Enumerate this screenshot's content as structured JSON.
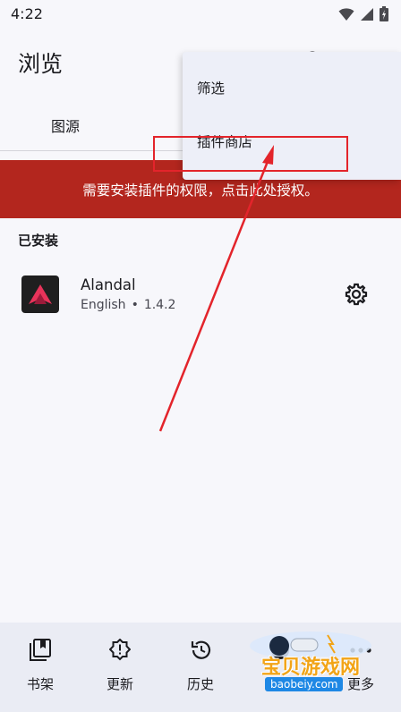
{
  "status_bar": {
    "time": "4:22"
  },
  "top_bar": {
    "title": "浏览"
  },
  "tabs": [
    {
      "label": "图源"
    }
  ],
  "banner": {
    "text": "需要安装插件的权限，点击此处授权。"
  },
  "installed": {
    "header": "已安装",
    "extensions": [
      {
        "name": "Alandal",
        "language": "English",
        "separator": "•",
        "version": "1.4.2"
      }
    ]
  },
  "menu": {
    "items": [
      {
        "label": "筛选"
      },
      {
        "label": "插件商店"
      }
    ]
  },
  "bottom_nav": {
    "items": [
      {
        "label": "书架"
      },
      {
        "label": "更新"
      },
      {
        "label": "历史"
      },
      {
        "label": "浏览"
      },
      {
        "label": "更多"
      }
    ]
  },
  "watermark": {
    "text": "宝贝游戏网",
    "url": "baobeiy.com"
  },
  "colors": {
    "banner": "#b3261e",
    "annotation": "#e3242b",
    "menu_bg": "#edeff8",
    "nav_bg": "#eaecf4"
  }
}
